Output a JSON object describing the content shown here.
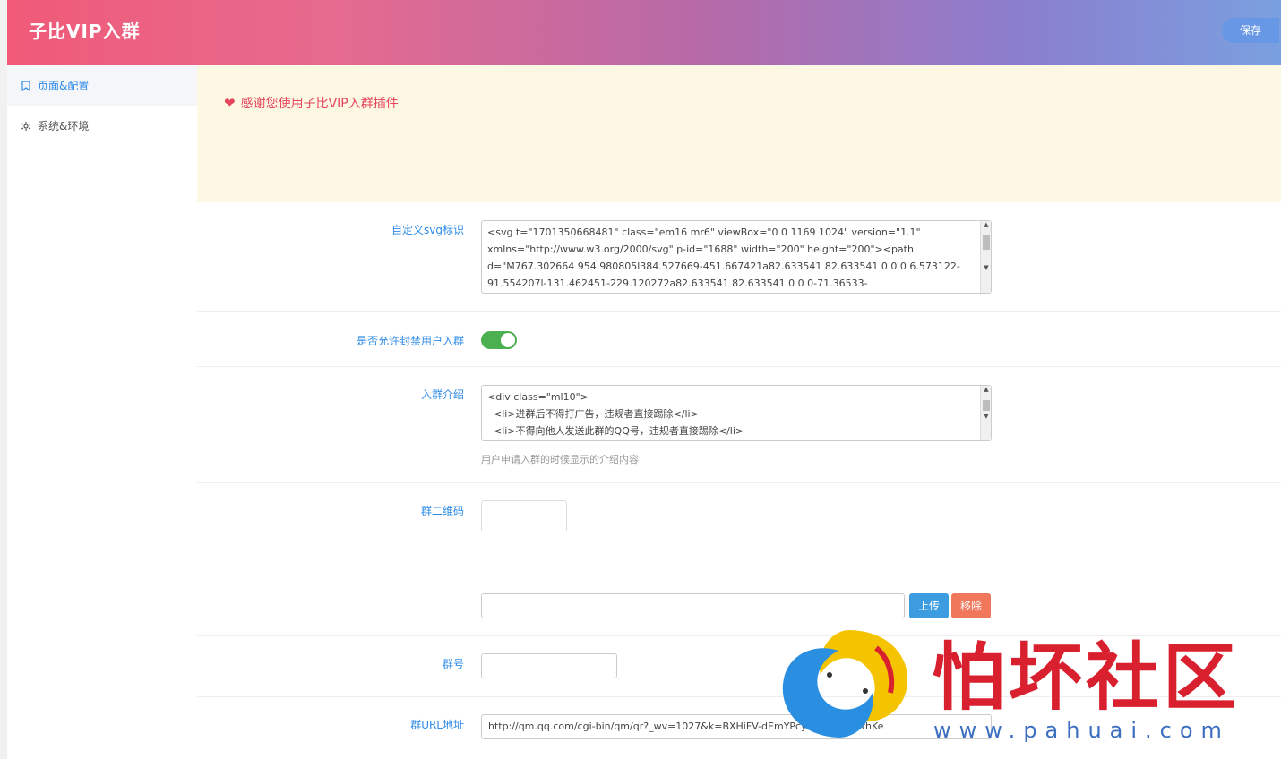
{
  "header": {
    "title": "子比VIP入群",
    "save_label": "保存"
  },
  "sidebar": {
    "items": [
      {
        "label": "页面&配置",
        "icon": "bookmark-icon",
        "active": true
      },
      {
        "label": "系统&环境",
        "icon": "settings-icon",
        "active": false
      }
    ]
  },
  "notice": {
    "text": "感谢您使用子比VIP入群插件",
    "icon": "heart-icon"
  },
  "form": {
    "svg_label": "自定义svg标识",
    "svg_value": "<svg t=\"1701350668481\" class=\"em16 mr6\" viewBox=\"0 0 1169 1024\" version=\"1.1\" xmlns=\"http://www.w3.org/2000/svg\" p-id=\"1688\" width=\"200\" height=\"200\"><path d=\"M767.302664 954.980805l384.527669-451.667421a82.633541 82.633541 0 0 0 6.573122-91.554207l-131.462451-229.120272a82.633541 82.633541 0 0 0-71.36533-",
    "ban_label": "是否允许封禁用户入群",
    "ban_enabled": true,
    "intro_label": "入群介绍",
    "intro_value": "<div class=\"ml10\">\n  <li>进群后不得打广告，违规者直接踢除</li>\n  <li>不得向他人发送此群的QQ号，违规者直接踢除</li>",
    "intro_hint": "用户申请入群的时候显示的介绍内容",
    "qr_label": "群二维码",
    "qr_value": "",
    "upload_label": "上传",
    "remove_label": "移除",
    "group_num_label": "群号",
    "group_num_value": "",
    "url_label": "群URL地址",
    "url_value": "http://qm.qq.com/cgi-bin/qm/qr?_wv=1027&k=BXHiFV-dEmYPcyzsEl-kp&authKe"
  },
  "watermark": {
    "text": "怕坏社区",
    "url": "www.pahuai.com"
  },
  "colors": {
    "accent": "#2e8be8",
    "notice_bg": "#fcf8e3",
    "notice_text": "#e6455b",
    "toggle_on": "#4caf50",
    "upload": "#3d9be0",
    "remove": "#f0775b"
  }
}
